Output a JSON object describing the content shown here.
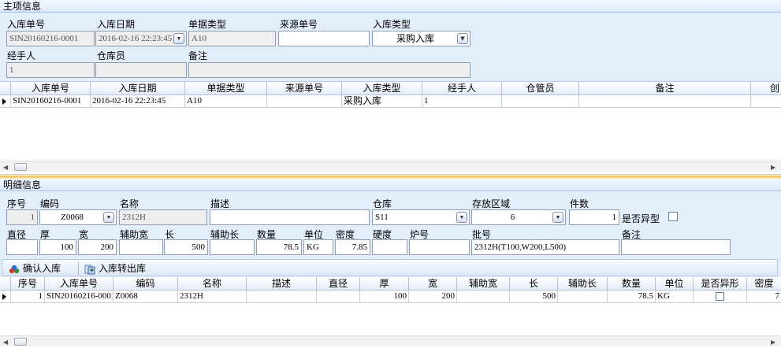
{
  "master": {
    "title": "主项信息",
    "labels": {
      "order_no": "入库单号",
      "date": "入库日期",
      "doc_type": "单据类型",
      "source_no": "来源单号",
      "in_type": "入库类型",
      "handler": "经手人",
      "keeper": "仓库员",
      "remark": "备注"
    },
    "values": {
      "order_no": "SIN20160216-0001",
      "date": "2016-02-16 22:23:45",
      "doc_type": "A10",
      "source_no": "",
      "in_type": "采购入库",
      "handler": "1",
      "keeper": "",
      "remark": ""
    }
  },
  "master_grid": {
    "columns": [
      "入库单号",
      "入库日期",
      "单据类型",
      "来源单号",
      "入库类型",
      "经手人",
      "仓管员",
      "备注",
      "创"
    ],
    "rows": [
      [
        "SIN20160216-0001",
        "2016-02-16 22:23:45",
        "A10",
        "",
        "采购入库",
        "1",
        "",
        "",
        ""
      ]
    ]
  },
  "detail": {
    "title": "明细信息",
    "labels": {
      "seq": "序号",
      "code": "编码",
      "name": "名称",
      "desc": "描述",
      "warehouse": "仓库",
      "area": "存放区域",
      "pieces": "件数",
      "irregular": "是否异型",
      "diameter": "直径",
      "thick": "厚",
      "width": "宽",
      "aux_width": "辅助宽",
      "length": "长",
      "aux_length": "辅助长",
      "qty": "数量",
      "unit": "单位",
      "density": "密度",
      "hardness": "硬度",
      "furnace": "炉号",
      "batch": "批号",
      "remark": "备注"
    },
    "values": {
      "seq": "1",
      "code": "Z0068",
      "name": "2312H",
      "desc": "",
      "warehouse": "S11",
      "area": "6",
      "pieces": "1",
      "diameter": "",
      "thick": "100",
      "width": "200",
      "aux_width": "",
      "length": "500",
      "aux_length": "",
      "qty": "78.5",
      "unit": "KG",
      "density": "7.85",
      "hardness": "",
      "furnace": "",
      "batch": "2312H(T100,W200,L500)",
      "remark": ""
    }
  },
  "toolbar": {
    "confirm_label": "确认入库",
    "transfer_label": "入库转出库"
  },
  "detail_grid": {
    "columns": [
      "序号",
      "入库单号",
      "编码",
      "名称",
      "描述",
      "直径",
      "厚",
      "宽",
      "辅助宽",
      "长",
      "辅助长",
      "数量",
      "单位",
      "是否异形",
      "密度"
    ],
    "rows": [
      [
        "1",
        "SIN20160216-0001",
        "Z0068",
        "2312H",
        "",
        "",
        "100",
        "200",
        "",
        "500",
        "",
        "78.5",
        "KG",
        "",
        "7"
      ]
    ]
  },
  "colors": {
    "panel": "#e3eefb",
    "title_bar": "#dbe8fa",
    "splitter": "#f0c050"
  }
}
